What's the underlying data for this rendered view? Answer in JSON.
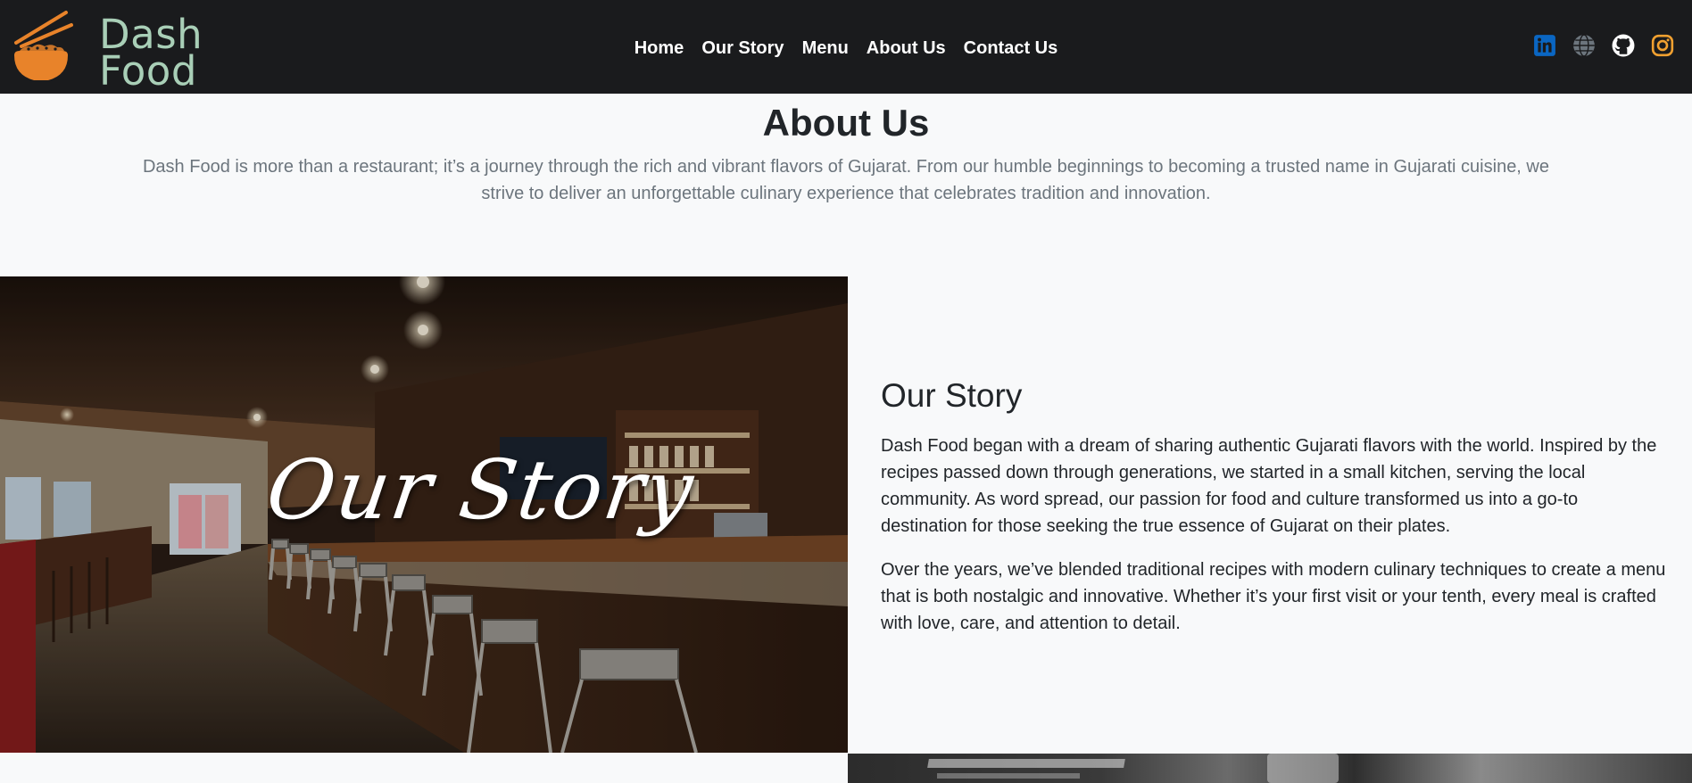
{
  "navbar": {
    "brand": {
      "line1": "Dash",
      "line2": "Food"
    },
    "links": [
      "Home",
      "Our Story",
      "Menu",
      "About Us",
      "Contact Us"
    ],
    "socials": [
      "linkedin-icon",
      "globe-icon",
      "github-icon",
      "instagram-icon"
    ]
  },
  "about": {
    "title": "About Us",
    "text": "Dash Food is more than a restaurant; it’s a journey through the rich and vibrant flavors of Gujarat. From our humble beginnings to becoming a trusted name in Gujarati cuisine, we strive to deliver an unforgettable culinary experience that celebrates tradition and innovation."
  },
  "story": {
    "overlay": "Our Story",
    "heading": "Our Story",
    "paragraphs": [
      "Dash Food began with a dream of sharing authentic Gujarati flavors with the world. Inspired by the recipes passed down through generations, we started in a small kitchen, serving the local community. As word spread, our passion for food and culture transformed us into a go-to destination for those seeking the true essence of Gujarat on their plates.",
      "Over the years, we’ve blended traditional recipes with modern culinary techniques to create a menu that is both nostalgic and innovative. Whether it’s your first visit or your tenth, every meal is crafted with love, care, and attention to detail."
    ]
  },
  "colors": {
    "navbar_bg": "#1a1b1d",
    "brand_text": "#a9cfb7",
    "logo_orange": "#e8832a",
    "linkedin": "#0a66c2",
    "instagram": "#f0a030",
    "page_bg": "#f8f9fa"
  }
}
